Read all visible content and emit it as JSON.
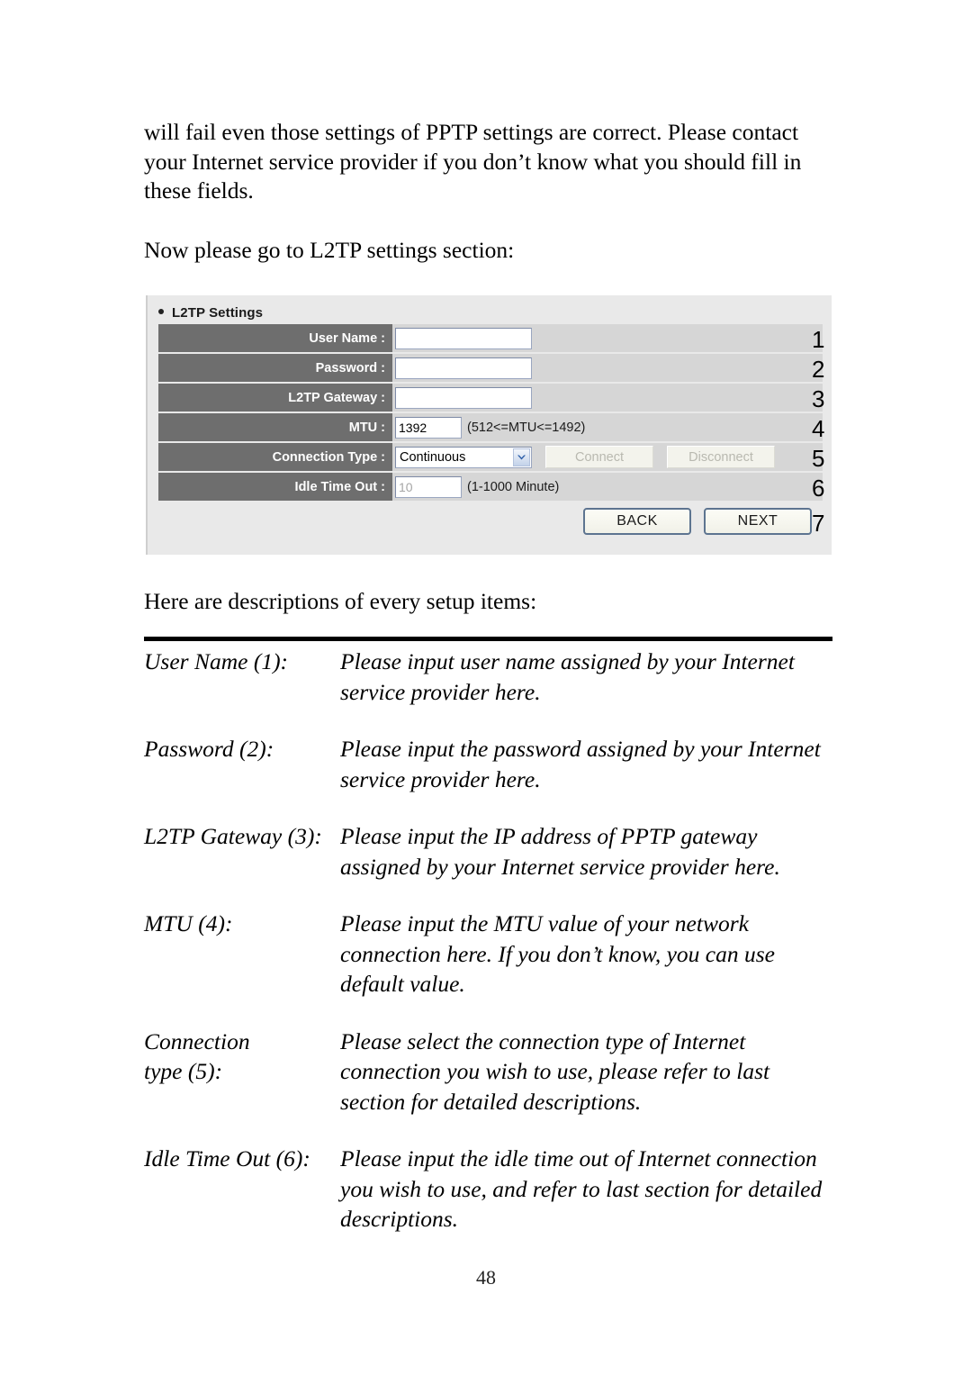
{
  "document": {
    "page_number": "48",
    "paragraphs": {
      "intro": "will fail even those settings of PPTP settings are correct. Please contact your Internet service provider if you don’t know what you should fill in these fields.",
      "now_go_to": "Now please go to L2TP settings section:",
      "here_are": "Here are descriptions of every setup items:"
    }
  },
  "screenshot": {
    "section_title": "L2TP Settings",
    "rows": [
      {
        "label": "User Name :",
        "value": "",
        "placeholder": "",
        "hint": "",
        "callout": "1"
      },
      {
        "label": "Password :",
        "value": "",
        "placeholder": "",
        "hint": "",
        "callout": "2"
      },
      {
        "label": "L2TP Gateway :",
        "value": "",
        "placeholder": "",
        "hint": "",
        "callout": "3"
      },
      {
        "label": "MTU :",
        "value": "1392",
        "placeholder": "",
        "hint": "(512<=MTU<=1492)",
        "callout": "4"
      },
      {
        "label": "Connection Type :",
        "value": "Continuous",
        "placeholder": "",
        "hint": "",
        "callout": "5"
      },
      {
        "label": "Idle Time Out :",
        "value": "10",
        "placeholder": "",
        "hint": "(1-1000 Minute)",
        "callout": "6"
      }
    ],
    "connection_type_selected": "Continuous",
    "connect_button": "Connect",
    "disconnect_button": "Disconnect",
    "back_button": "BACK",
    "next_button": "NEXT",
    "nav_callout": "7",
    "colors": {
      "panel_background": "#e9e9e9",
      "row_background": "#d6d6d6",
      "label_background": "#6e6e6e",
      "label_text": "#ffffff",
      "input_border": "#9aa6c0",
      "select_arrow": "#2d5fa8",
      "nav_button_border": "#5d7490"
    }
  },
  "descriptions": [
    {
      "term": "User Name (1):",
      "definition": "Please input user name assigned by your Internet service provider here."
    },
    {
      "term": "Password (2):",
      "definition": "Please input the password assigned by your Internet service provider here."
    },
    {
      "term": "L2TP Gateway (3):",
      "definition": "Please input the IP address of PPTP gateway assigned by your Internet service provider here."
    },
    {
      "term": "MTU (4):",
      "definition": "Please input the MTU value of your network connection here. If you don’t know, you can use default value."
    },
    {
      "term": "Connection\ntype (5):",
      "definition": "Please select the connection type of Internet connection you wish to use, please refer to last section for detailed descriptions."
    },
    {
      "term": "Idle Time Out (6):",
      "definition": "Please input the idle time out of Internet connection you wish to use, and refer to last section for detailed descriptions."
    }
  ]
}
